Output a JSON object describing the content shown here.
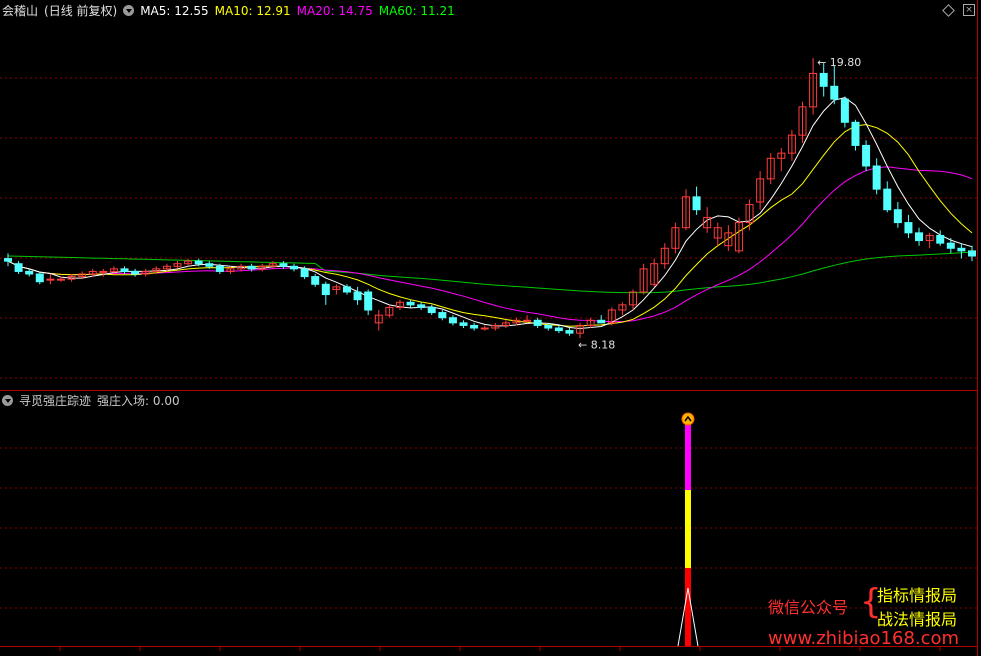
{
  "main_panel": {
    "stock_name": "会稽山",
    "period_label": "(日线 前复权)",
    "ma_labels": [
      {
        "text": "MA5: 12.55",
        "color": "#ffffff"
      },
      {
        "text": "MA10: 12.91",
        "color": "#ffff00"
      },
      {
        "text": "MA20: 14.75",
        "color": "#ff00ff"
      },
      {
        "text": "MA60: 11.21",
        "color": "#00ff00"
      }
    ],
    "high_label": "19.80",
    "low_label": "8.18"
  },
  "indicator_panel": {
    "name": "寻觅强庄踪迹",
    "value_label": "强庄入场: 0.00"
  },
  "watermark": {
    "wechat": "微信公众号",
    "line1": "指标情报局",
    "line2": "战法情报局",
    "url": "www.zhibiao168.com"
  },
  "colors": {
    "up": "#ff3c3c",
    "down": "#54ffff",
    "ma5": "#ffffff",
    "ma10": "#ffff00",
    "ma20": "#ff00ff",
    "ma60": "#00c800",
    "grid": "#8c0000"
  },
  "chart_data": {
    "type": "candlestick",
    "price_range": [
      7.2,
      21.2
    ],
    "candles": [
      [
        12.0,
        12.2,
        11.7,
        11.9
      ],
      [
        11.8,
        11.9,
        11.4,
        11.5
      ],
      [
        11.5,
        11.6,
        11.3,
        11.4
      ],
      [
        11.4,
        11.5,
        11.0,
        11.1
      ],
      [
        11.2,
        11.4,
        11.0,
        11.2
      ],
      [
        11.2,
        11.3,
        11.1,
        11.2
      ],
      [
        11.2,
        11.4,
        11.1,
        11.3
      ],
      [
        11.3,
        11.5,
        11.2,
        11.4
      ],
      [
        11.4,
        11.6,
        11.3,
        11.5
      ],
      [
        11.5,
        11.6,
        11.3,
        11.5
      ],
      [
        11.5,
        11.7,
        11.4,
        11.6
      ],
      [
        11.6,
        11.7,
        11.4,
        11.5
      ],
      [
        11.5,
        11.6,
        11.3,
        11.4
      ],
      [
        11.4,
        11.6,
        11.3,
        11.5
      ],
      [
        11.5,
        11.7,
        11.4,
        11.6
      ],
      [
        11.6,
        11.8,
        11.5,
        11.7
      ],
      [
        11.7,
        11.9,
        11.6,
        11.8
      ],
      [
        11.8,
        12.0,
        11.7,
        11.9
      ],
      [
        11.9,
        12.0,
        11.7,
        11.8
      ],
      [
        11.8,
        11.9,
        11.6,
        11.7
      ],
      [
        11.7,
        11.8,
        11.4,
        11.5
      ],
      [
        11.5,
        11.7,
        11.4,
        11.6
      ],
      [
        11.6,
        11.8,
        11.5,
        11.7
      ],
      [
        11.7,
        11.8,
        11.5,
        11.6
      ],
      [
        11.6,
        11.8,
        11.5,
        11.7
      ],
      [
        11.7,
        11.9,
        11.6,
        11.8
      ],
      [
        11.8,
        11.9,
        11.6,
        11.7
      ],
      [
        11.7,
        11.8,
        11.5,
        11.6
      ],
      [
        11.6,
        11.7,
        11.2,
        11.3
      ],
      [
        11.3,
        11.4,
        10.9,
        11.0
      ],
      [
        11.0,
        11.1,
        10.2,
        10.6
      ],
      [
        10.8,
        11.0,
        10.6,
        10.9
      ],
      [
        10.9,
        11.0,
        10.6,
        10.7
      ],
      [
        10.7,
        10.9,
        10.2,
        10.4
      ],
      [
        10.7,
        10.8,
        9.8,
        10.0
      ],
      [
        9.5,
        10.0,
        9.2,
        9.8
      ],
      [
        9.8,
        10.2,
        9.7,
        10.1
      ],
      [
        10.1,
        10.4,
        10.0,
        10.3
      ],
      [
        10.3,
        10.4,
        10.1,
        10.2
      ],
      [
        10.2,
        10.3,
        10.0,
        10.1
      ],
      [
        10.1,
        10.2,
        9.8,
        9.9
      ],
      [
        9.9,
        10.0,
        9.6,
        9.7
      ],
      [
        9.7,
        9.8,
        9.4,
        9.5
      ],
      [
        9.5,
        9.6,
        9.3,
        9.4
      ],
      [
        9.4,
        9.5,
        9.2,
        9.3
      ],
      [
        9.3,
        9.4,
        9.2,
        9.3
      ],
      [
        9.3,
        9.5,
        9.2,
        9.4
      ],
      [
        9.4,
        9.6,
        9.3,
        9.5
      ],
      [
        9.5,
        9.7,
        9.4,
        9.6
      ],
      [
        9.6,
        9.8,
        9.5,
        9.6
      ],
      [
        9.6,
        9.7,
        9.3,
        9.4
      ],
      [
        9.4,
        9.5,
        9.2,
        9.3
      ],
      [
        9.3,
        9.4,
        9.1,
        9.2
      ],
      [
        9.2,
        9.3,
        9.0,
        9.1
      ],
      [
        9.1,
        9.5,
        8.9,
        9.4
      ],
      [
        9.4,
        9.7,
        9.3,
        9.6
      ],
      [
        9.6,
        9.8,
        9.5,
        9.5
      ],
      [
        9.5,
        10.1,
        9.4,
        10.0
      ],
      [
        10.0,
        10.3,
        9.8,
        10.2
      ],
      [
        10.2,
        10.8,
        10.0,
        10.7
      ],
      [
        10.7,
        11.8,
        10.6,
        11.6
      ],
      [
        11.0,
        12.0,
        10.9,
        11.8
      ],
      [
        11.8,
        12.6,
        11.6,
        12.4
      ],
      [
        12.4,
        13.4,
        12.2,
        13.2
      ],
      [
        13.2,
        14.7,
        13.1,
        14.4
      ],
      [
        14.4,
        14.8,
        13.7,
        13.9
      ],
      [
        13.2,
        14.0,
        13.0,
        13.6
      ],
      [
        12.8,
        13.4,
        12.5,
        13.2
      ],
      [
        12.5,
        13.3,
        12.3,
        13.0
      ],
      [
        12.3,
        13.6,
        12.2,
        13.4
      ],
      [
        13.4,
        14.3,
        13.1,
        14.1
      ],
      [
        14.2,
        15.4,
        13.9,
        15.1
      ],
      [
        15.1,
        16.1,
        14.9,
        15.9
      ],
      [
        15.9,
        16.3,
        15.4,
        16.1
      ],
      [
        16.1,
        17.0,
        15.8,
        16.8
      ],
      [
        16.8,
        18.1,
        16.5,
        17.9
      ],
      [
        17.9,
        19.8,
        17.6,
        19.2
      ],
      [
        19.2,
        19.6,
        18.3,
        18.7
      ],
      [
        18.7,
        19.5,
        18.0,
        18.2
      ],
      [
        18.2,
        18.3,
        17.1,
        17.3
      ],
      [
        17.3,
        17.4,
        16.2,
        16.4
      ],
      [
        16.4,
        16.6,
        15.4,
        15.6
      ],
      [
        15.6,
        15.9,
        14.5,
        14.7
      ],
      [
        14.7,
        15.0,
        13.8,
        13.9
      ],
      [
        13.9,
        14.2,
        13.2,
        13.4
      ],
      [
        13.4,
        13.7,
        12.8,
        13.0
      ],
      [
        13.0,
        13.2,
        12.5,
        12.7
      ],
      [
        12.7,
        13.0,
        12.4,
        12.9
      ],
      [
        12.9,
        13.1,
        12.5,
        12.6
      ],
      [
        12.6,
        12.8,
        12.2,
        12.4
      ],
      [
        12.4,
        12.6,
        12.0,
        12.3
      ],
      [
        12.3,
        12.5,
        11.9,
        12.1
      ]
    ],
    "ma5_last": 12.55,
    "ma10_last": 12.91,
    "ma20_last": 14.75,
    "ma60_last": 11.21,
    "indicator_spike_index": 64
  }
}
